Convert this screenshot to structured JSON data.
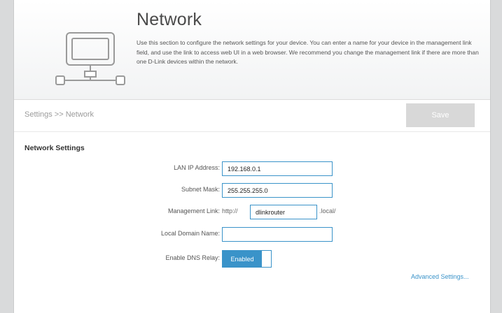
{
  "header": {
    "title": "Network",
    "description": "Use this section to configure the network settings for your device. You can enter a name for your device in the management link field, and use the link to access web UI in a web browser. We recommend you change the management link if there are more than one D-Link devices within the network.",
    "icon": "network-monitor-icon"
  },
  "breadcrumb": "Settings >> Network",
  "toolbar": {
    "save_label": "Save"
  },
  "section": {
    "title": "Network Settings",
    "lan_ip": {
      "label": "LAN IP Address:",
      "value": "192.168.0.1"
    },
    "subnet": {
      "label": "Subnet Mask:",
      "value": "255.255.255.0"
    },
    "mgmt": {
      "label": "Management Link:",
      "prefix": "http://",
      "value": "dlinkrouter",
      "suffix": ".local/"
    },
    "domain": {
      "label": "Local Domain Name:",
      "value": ""
    },
    "dns_relay": {
      "label": "Enable DNS Relay:",
      "state": "Enabled"
    }
  },
  "advanced_link": "Advanced Settings...",
  "colors": {
    "accent": "#3a93c9",
    "save_disabled": "#d8d8d8"
  }
}
